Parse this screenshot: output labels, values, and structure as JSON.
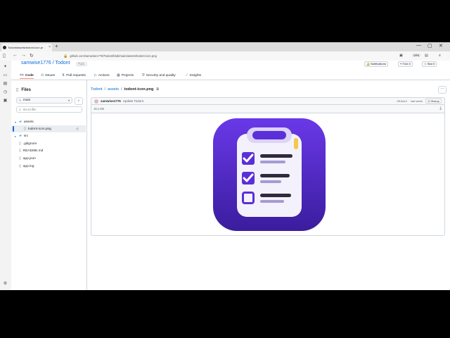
{
  "browser": {
    "tab_title": "Todont/assets/todont-icon.pr",
    "tab_close": "×",
    "new_tab": "+",
    "window_controls": [
      "—",
      "▢",
      "✕"
    ],
    "url": "github.com/samwise1776/Todont/blob/main/assets/todont-icon.png",
    "vpn_label": "VPN",
    "menu_icon": "≡"
  },
  "repo": {
    "owner_and_name": "samwise1776 / Todont",
    "visibility": "Public",
    "notifications_label": "Notifications",
    "fork_label": "Fork",
    "fork_count": "0",
    "star_label": "Star",
    "star_count": "0",
    "nav": [
      {
        "icon": "<>",
        "label": "Code",
        "active": true
      },
      {
        "icon": "⊙",
        "label": "Issues"
      },
      {
        "icon": "⇅",
        "label": "Pull requests"
      },
      {
        "icon": "▷",
        "label": "Actions"
      },
      {
        "icon": "▦",
        "label": "Projects"
      },
      {
        "icon": "⛨",
        "label": "Security and quality"
      },
      {
        "icon": "⟋",
        "label": "Insights"
      }
    ]
  },
  "tree": {
    "header": "Files",
    "branch": "main",
    "filter_placeholder": "Go to file",
    "items": [
      {
        "label": "assets",
        "type": "folder",
        "open": true
      },
      {
        "label": "todont-icon.png",
        "type": "file",
        "selected": true
      },
      {
        "label": "src",
        "type": "folder",
        "open": false
      },
      {
        "label": ".gitignore",
        "type": "file"
      },
      {
        "label": "README.md",
        "type": "file"
      },
      {
        "label": "app.json",
        "type": "file"
      },
      {
        "label": "app.log",
        "type": "file"
      }
    ]
  },
  "file": {
    "crumbs": {
      "repo": "Todont",
      "folder": "assets",
      "file": "todont-icon.png"
    },
    "commit": {
      "author": "samwise1776",
      "message": "Update Todont",
      "hash": "0f13a14",
      "time": "last week",
      "history_label": "History"
    },
    "size": "15.1 KB"
  },
  "colors": {
    "link": "#0969da",
    "icon_bg_top": "#6a38e8",
    "icon_bg_bottom": "#3a1d9e",
    "check_purple": "#5b2fd8"
  }
}
